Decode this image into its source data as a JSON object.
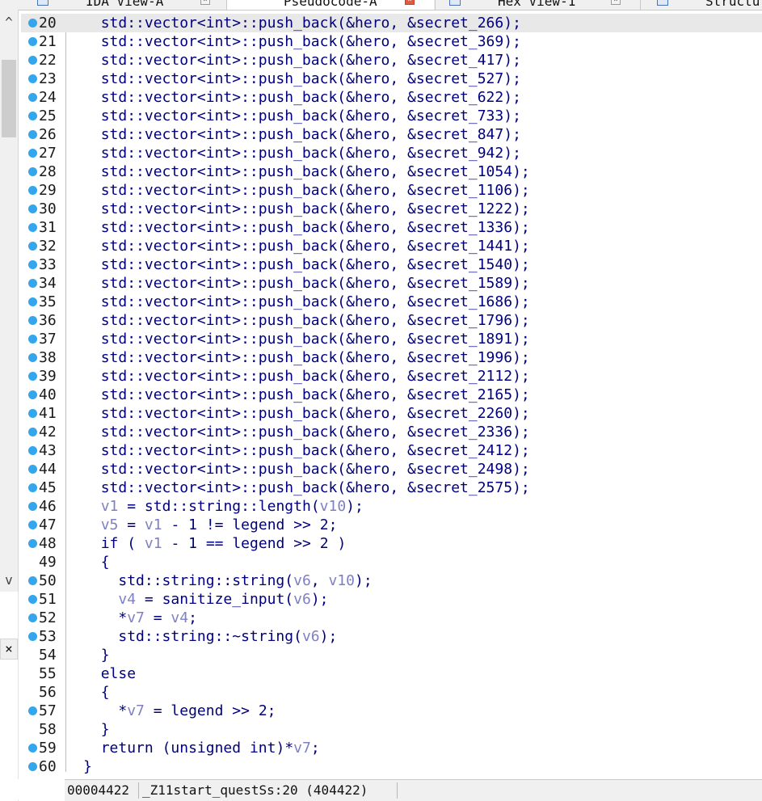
{
  "tabs": [
    {
      "label": "IDA View-A",
      "icon": "disassembly-icon",
      "active": false
    },
    {
      "label": "Pseudocode-A",
      "icon": "pseudocode-icon",
      "active": true
    },
    {
      "label": "Hex View-1",
      "icon": "hex-icon",
      "active": false
    },
    {
      "label": "Structur",
      "icon": "structures-icon",
      "active": false
    }
  ],
  "scroll": {
    "up": "^",
    "down": "v"
  },
  "close_label": "×",
  "code_lines": [
    {
      "num": "20",
      "bp": true,
      "text": "  std::vector<int>::push_back(&hero, &secret_266);"
    },
    {
      "num": "21",
      "bp": true,
      "text": "  std::vector<int>::push_back(&hero, &secret_369);"
    },
    {
      "num": "22",
      "bp": true,
      "text": "  std::vector<int>::push_back(&hero, &secret_417);"
    },
    {
      "num": "23",
      "bp": true,
      "text": "  std::vector<int>::push_back(&hero, &secret_527);"
    },
    {
      "num": "24",
      "bp": true,
      "text": "  std::vector<int>::push_back(&hero, &secret_622);"
    },
    {
      "num": "25",
      "bp": true,
      "text": "  std::vector<int>::push_back(&hero, &secret_733);"
    },
    {
      "num": "26",
      "bp": true,
      "text": "  std::vector<int>::push_back(&hero, &secret_847);"
    },
    {
      "num": "27",
      "bp": true,
      "text": "  std::vector<int>::push_back(&hero, &secret_942);"
    },
    {
      "num": "28",
      "bp": true,
      "text": "  std::vector<int>::push_back(&hero, &secret_1054);"
    },
    {
      "num": "29",
      "bp": true,
      "text": "  std::vector<int>::push_back(&hero, &secret_1106);"
    },
    {
      "num": "30",
      "bp": true,
      "text": "  std::vector<int>::push_back(&hero, &secret_1222);"
    },
    {
      "num": "31",
      "bp": true,
      "text": "  std::vector<int>::push_back(&hero, &secret_1336);"
    },
    {
      "num": "32",
      "bp": true,
      "text": "  std::vector<int>::push_back(&hero, &secret_1441);"
    },
    {
      "num": "33",
      "bp": true,
      "text": "  std::vector<int>::push_back(&hero, &secret_1540);"
    },
    {
      "num": "34",
      "bp": true,
      "text": "  std::vector<int>::push_back(&hero, &secret_1589);"
    },
    {
      "num": "35",
      "bp": true,
      "text": "  std::vector<int>::push_back(&hero, &secret_1686);"
    },
    {
      "num": "36",
      "bp": true,
      "text": "  std::vector<int>::push_back(&hero, &secret_1796);"
    },
    {
      "num": "37",
      "bp": true,
      "text": "  std::vector<int>::push_back(&hero, &secret_1891);"
    },
    {
      "num": "38",
      "bp": true,
      "text": "  std::vector<int>::push_back(&hero, &secret_1996);"
    },
    {
      "num": "39",
      "bp": true,
      "text": "  std::vector<int>::push_back(&hero, &secret_2112);"
    },
    {
      "num": "40",
      "bp": true,
      "text": "  std::vector<int>::push_back(&hero, &secret_2165);"
    },
    {
      "num": "41",
      "bp": true,
      "text": "  std::vector<int>::push_back(&hero, &secret_2260);"
    },
    {
      "num": "42",
      "bp": true,
      "text": "  std::vector<int>::push_back(&hero, &secret_2336);"
    },
    {
      "num": "43",
      "bp": true,
      "text": "  std::vector<int>::push_back(&hero, &secret_2412);"
    },
    {
      "num": "44",
      "bp": true,
      "text": "  std::vector<int>::push_back(&hero, &secret_2498);"
    },
    {
      "num": "45",
      "bp": true,
      "text": "  std::vector<int>::push_back(&hero, &secret_2575);"
    },
    {
      "num": "46",
      "bp": true,
      "text": "  v1 = std::string::length(v10);"
    },
    {
      "num": "47",
      "bp": true,
      "text": "  v5 = v1 - 1 != legend >> 2;"
    },
    {
      "num": "48",
      "bp": true,
      "text": "  if ( v1 - 1 == legend >> 2 )"
    },
    {
      "num": "49",
      "bp": false,
      "text": "  {"
    },
    {
      "num": "50",
      "bp": true,
      "text": "    std::string::string(v6, v10);"
    },
    {
      "num": "51",
      "bp": true,
      "text": "    v4 = sanitize_input(v6);"
    },
    {
      "num": "52",
      "bp": true,
      "text": "    *v7 = v4;"
    },
    {
      "num": "53",
      "bp": true,
      "text": "    std::string::~string(v6);"
    },
    {
      "num": "54",
      "bp": false,
      "text": "  }"
    },
    {
      "num": "55",
      "bp": false,
      "text": "  else"
    },
    {
      "num": "56",
      "bp": false,
      "text": "  {"
    },
    {
      "num": "57",
      "bp": true,
      "text": "    *v7 = legend >> 2;"
    },
    {
      "num": "58",
      "bp": false,
      "text": "  }"
    },
    {
      "num": "59",
      "bp": true,
      "text": "  return (unsigned int)*v7;"
    },
    {
      "num": "60",
      "bp": true,
      "text": "}"
    }
  ],
  "status": {
    "address": "00004422",
    "location": "_Z11start_questSs:20 (404422)"
  },
  "colors": {
    "keyword": "#00007f",
    "variable": "#7f80c4",
    "breakpoint": "#33a6ee"
  }
}
